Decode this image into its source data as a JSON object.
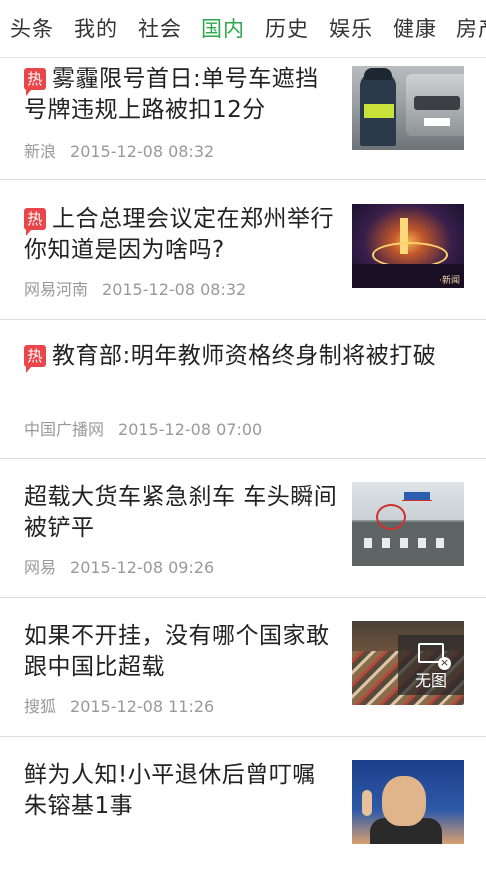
{
  "tabs": [
    {
      "label": "头条",
      "active": false
    },
    {
      "label": "我的",
      "active": false
    },
    {
      "label": "社会",
      "active": false
    },
    {
      "label": "国内",
      "active": true
    },
    {
      "label": "历史",
      "active": false
    },
    {
      "label": "娱乐",
      "active": false
    },
    {
      "label": "健康",
      "active": false
    },
    {
      "label": "房产",
      "active": false
    }
  ],
  "hot_badge": "热",
  "no_image_label": "无图",
  "news": [
    {
      "hot": true,
      "title": "雾霾限号首日:单号车遮挡号牌违规上路被扣12分",
      "source": "新浪",
      "time": "2015-12-08 08:32",
      "thumb": "traffic-police-image"
    },
    {
      "hot": true,
      "title": "上合总理会议定在郑州举行 你知道是因为啥吗?",
      "source": "网易河南",
      "time": "2015-12-08 08:32",
      "thumb": "city-night-image"
    },
    {
      "hot": true,
      "title": "教育部:明年教师资格终身制将被打破",
      "source": "中国广播网",
      "time": "2015-12-08 07:00",
      "thumb": null
    },
    {
      "hot": false,
      "title": "超载大货车紧急刹车 车头瞬间被铲平",
      "source": "网易",
      "time": "2015-12-08 09:26",
      "thumb": "road-crash-image"
    },
    {
      "hot": false,
      "title": "如果不开挂，没有哪个国家敢跟中国比超载",
      "source": "搜狐",
      "time": "2015-12-08 11:26",
      "thumb": "overload-cart-image"
    },
    {
      "hot": false,
      "title": "鲜为人知!小平退休后曾叮嘱朱镕基1事",
      "source": "",
      "time": "",
      "thumb": "portrait-image"
    }
  ],
  "colors": {
    "active_tab": "#2aa84a",
    "hot_badge": "#e8464a",
    "meta_text": "#999999"
  }
}
